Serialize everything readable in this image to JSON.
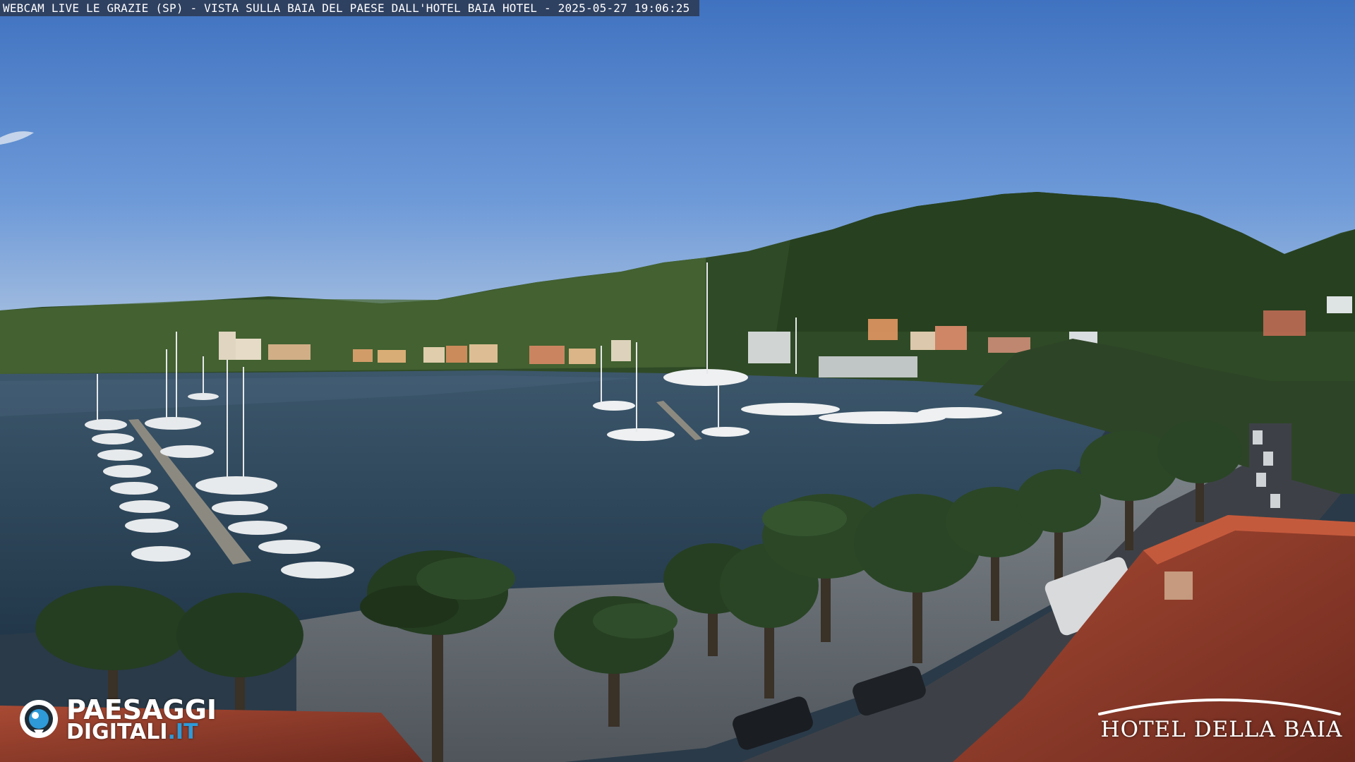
{
  "overlay": {
    "caption": "WEBCAM LIVE LE GRAZIE (SP) - VISTA SULLA BAIA DEL PAESE DALL'HOTEL BAIA HOTEL - 2025-05-27 19:06:25"
  },
  "watermarks": {
    "left_logo": {
      "line1": "PAESAGGI",
      "line2_a": "DIGITALI",
      "line2_b": ".IT"
    },
    "right_logo": {
      "text": "HOTEL DELLA BAIA"
    }
  },
  "scene": {
    "sky": "clear blue evening sky",
    "sea_color": "#2b4356",
    "hill_color": "#2f4a26",
    "roof_color": "#9a3e2c",
    "accent_blue": "#2e9ad8"
  }
}
